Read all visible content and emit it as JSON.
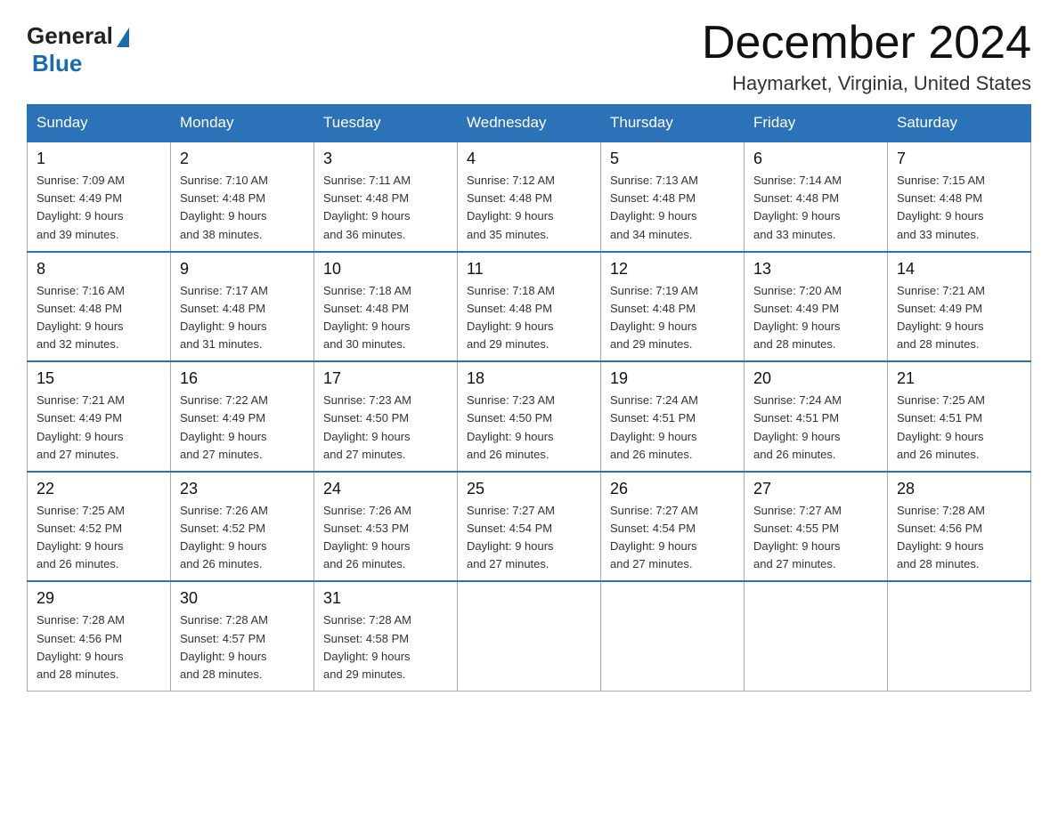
{
  "header": {
    "logo_general": "General",
    "logo_blue": "Blue",
    "title": "December 2024",
    "location": "Haymarket, Virginia, United States"
  },
  "days_of_week": [
    "Sunday",
    "Monday",
    "Tuesday",
    "Wednesday",
    "Thursday",
    "Friday",
    "Saturday"
  ],
  "weeks": [
    [
      {
        "day": "1",
        "sunrise": "7:09 AM",
        "sunset": "4:49 PM",
        "daylight": "9 hours and 39 minutes."
      },
      {
        "day": "2",
        "sunrise": "7:10 AM",
        "sunset": "4:48 PM",
        "daylight": "9 hours and 38 minutes."
      },
      {
        "day": "3",
        "sunrise": "7:11 AM",
        "sunset": "4:48 PM",
        "daylight": "9 hours and 36 minutes."
      },
      {
        "day": "4",
        "sunrise": "7:12 AM",
        "sunset": "4:48 PM",
        "daylight": "9 hours and 35 minutes."
      },
      {
        "day": "5",
        "sunrise": "7:13 AM",
        "sunset": "4:48 PM",
        "daylight": "9 hours and 34 minutes."
      },
      {
        "day": "6",
        "sunrise": "7:14 AM",
        "sunset": "4:48 PM",
        "daylight": "9 hours and 33 minutes."
      },
      {
        "day": "7",
        "sunrise": "7:15 AM",
        "sunset": "4:48 PM",
        "daylight": "9 hours and 33 minutes."
      }
    ],
    [
      {
        "day": "8",
        "sunrise": "7:16 AM",
        "sunset": "4:48 PM",
        "daylight": "9 hours and 32 minutes."
      },
      {
        "day": "9",
        "sunrise": "7:17 AM",
        "sunset": "4:48 PM",
        "daylight": "9 hours and 31 minutes."
      },
      {
        "day": "10",
        "sunrise": "7:18 AM",
        "sunset": "4:48 PM",
        "daylight": "9 hours and 30 minutes."
      },
      {
        "day": "11",
        "sunrise": "7:18 AM",
        "sunset": "4:48 PM",
        "daylight": "9 hours and 29 minutes."
      },
      {
        "day": "12",
        "sunrise": "7:19 AM",
        "sunset": "4:48 PM",
        "daylight": "9 hours and 29 minutes."
      },
      {
        "day": "13",
        "sunrise": "7:20 AM",
        "sunset": "4:49 PM",
        "daylight": "9 hours and 28 minutes."
      },
      {
        "day": "14",
        "sunrise": "7:21 AM",
        "sunset": "4:49 PM",
        "daylight": "9 hours and 28 minutes."
      }
    ],
    [
      {
        "day": "15",
        "sunrise": "7:21 AM",
        "sunset": "4:49 PM",
        "daylight": "9 hours and 27 minutes."
      },
      {
        "day": "16",
        "sunrise": "7:22 AM",
        "sunset": "4:49 PM",
        "daylight": "9 hours and 27 minutes."
      },
      {
        "day": "17",
        "sunrise": "7:23 AM",
        "sunset": "4:50 PM",
        "daylight": "9 hours and 27 minutes."
      },
      {
        "day": "18",
        "sunrise": "7:23 AM",
        "sunset": "4:50 PM",
        "daylight": "9 hours and 26 minutes."
      },
      {
        "day": "19",
        "sunrise": "7:24 AM",
        "sunset": "4:51 PM",
        "daylight": "9 hours and 26 minutes."
      },
      {
        "day": "20",
        "sunrise": "7:24 AM",
        "sunset": "4:51 PM",
        "daylight": "9 hours and 26 minutes."
      },
      {
        "day": "21",
        "sunrise": "7:25 AM",
        "sunset": "4:51 PM",
        "daylight": "9 hours and 26 minutes."
      }
    ],
    [
      {
        "day": "22",
        "sunrise": "7:25 AM",
        "sunset": "4:52 PM",
        "daylight": "9 hours and 26 minutes."
      },
      {
        "day": "23",
        "sunrise": "7:26 AM",
        "sunset": "4:52 PM",
        "daylight": "9 hours and 26 minutes."
      },
      {
        "day": "24",
        "sunrise": "7:26 AM",
        "sunset": "4:53 PM",
        "daylight": "9 hours and 26 minutes."
      },
      {
        "day": "25",
        "sunrise": "7:27 AM",
        "sunset": "4:54 PM",
        "daylight": "9 hours and 27 minutes."
      },
      {
        "day": "26",
        "sunrise": "7:27 AM",
        "sunset": "4:54 PM",
        "daylight": "9 hours and 27 minutes."
      },
      {
        "day": "27",
        "sunrise": "7:27 AM",
        "sunset": "4:55 PM",
        "daylight": "9 hours and 27 minutes."
      },
      {
        "day": "28",
        "sunrise": "7:28 AM",
        "sunset": "4:56 PM",
        "daylight": "9 hours and 28 minutes."
      }
    ],
    [
      {
        "day": "29",
        "sunrise": "7:28 AM",
        "sunset": "4:56 PM",
        "daylight": "9 hours and 28 minutes."
      },
      {
        "day": "30",
        "sunrise": "7:28 AM",
        "sunset": "4:57 PM",
        "daylight": "9 hours and 28 minutes."
      },
      {
        "day": "31",
        "sunrise": "7:28 AM",
        "sunset": "4:58 PM",
        "daylight": "9 hours and 29 minutes."
      },
      null,
      null,
      null,
      null
    ]
  ],
  "labels": {
    "sunrise": "Sunrise: ",
    "sunset": "Sunset: ",
    "daylight": "Daylight: "
  }
}
